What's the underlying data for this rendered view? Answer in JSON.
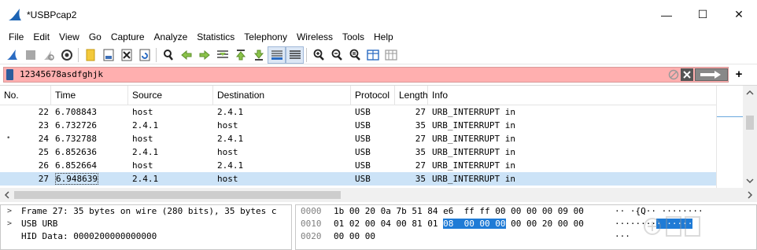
{
  "window": {
    "title": "*USBPcap2",
    "minimize": "—",
    "maximize": "☐",
    "close": "✕"
  },
  "menu": [
    "File",
    "Edit",
    "View",
    "Go",
    "Capture",
    "Analyze",
    "Statistics",
    "Telephony",
    "Wireless",
    "Tools",
    "Help"
  ],
  "toolbar": {
    "icons": [
      "shark-fin-start-icon",
      "stop-icon",
      "restart-icon",
      "capture-options-icon",
      "open-file-icon",
      "binary-file-icon",
      "close-file-icon",
      "reload-icon",
      "find-icon",
      "back-arrow-icon",
      "forward-arrow-icon",
      "go-to-packet-icon",
      "first-packet-icon",
      "last-packet-icon",
      "autoscroll-icon",
      "colorize-icon",
      "zoom-in-icon",
      "zoom-out-icon",
      "normal-size-icon",
      "resize-columns-icon",
      "expand-subtrees-icon"
    ]
  },
  "filter": {
    "value": "12345678asdfghjk",
    "bg_color": "#ffafaf"
  },
  "columns": [
    "No.",
    "Time",
    "Source",
    "Destination",
    "Protocol",
    "Length",
    "Info"
  ],
  "packets": [
    {
      "no": "22",
      "time": "6.708843",
      "src": "host",
      "dst": "2.4.1",
      "proto": "USB",
      "len": "27",
      "info": "URB_INTERRUPT in",
      "mark": ""
    },
    {
      "no": "23",
      "time": "6.732726",
      "src": "2.4.1",
      "dst": "host",
      "proto": "USB",
      "len": "35",
      "info": "URB_INTERRUPT in",
      "mark": ""
    },
    {
      "no": "24",
      "time": "6.732788",
      "src": "host",
      "dst": "2.4.1",
      "proto": "USB",
      "len": "27",
      "info": "URB_INTERRUPT in",
      "mark": "•"
    },
    {
      "no": "25",
      "time": "6.852636",
      "src": "2.4.1",
      "dst": "host",
      "proto": "USB",
      "len": "35",
      "info": "URB_INTERRUPT in",
      "mark": ""
    },
    {
      "no": "26",
      "time": "6.852664",
      "src": "host",
      "dst": "2.4.1",
      "proto": "USB",
      "len": "27",
      "info": "URB_INTERRUPT in",
      "mark": ""
    },
    {
      "no": "27",
      "time": "6.948639",
      "src": "2.4.1",
      "dst": "host",
      "proto": "USB",
      "len": "35",
      "info": "URB_INTERRUPT in",
      "mark": ""
    }
  ],
  "selected_packet": "27",
  "details": [
    {
      "arrow": ">",
      "text": "Frame 27: 35 bytes on wire (280 bits), 35 bytes c"
    },
    {
      "arrow": ">",
      "text": "USB URB"
    },
    {
      "arrow": "",
      "text": "HID Data: 0000200000000000"
    }
  ],
  "bytes": [
    {
      "offset": "0000",
      "pre": "1b 00 20 0a 7b 51 84 e6  ff ff 00 00 00 00 09 00",
      "hl": "",
      "post": "",
      "ascii_pre": "·· ·{Q·· ········",
      "ascii_hl": "",
      "ascii_post": ""
    },
    {
      "offset": "0010",
      "pre": "01 02 00 04 00 81 01 ",
      "hl": "08  00 00 00",
      "post": " 00 00 20 00 00",
      "ascii_pre": "········",
      "ascii_hl": "· ·····",
      "ascii_post": ""
    },
    {
      "offset": "0020",
      "pre": "00 00 00",
      "hl": "",
      "post": "",
      "ascii_pre": "···",
      "ascii_hl": "",
      "ascii_post": ""
    }
  ]
}
